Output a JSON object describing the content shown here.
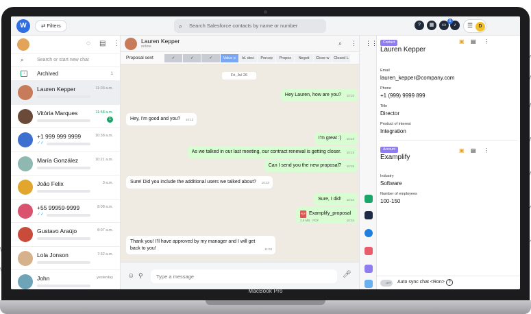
{
  "device": {
    "label": "MacBook Pro"
  },
  "topbar": {
    "logo": "W",
    "filters_label": "Filters",
    "search_placeholder": "Search Salesforce contacts by name or number",
    "notifications_count": "5",
    "avatar_initial": "D"
  },
  "left": {
    "search_placeholder": "Search or start new chat",
    "archived": {
      "label": "Archived",
      "count": "1"
    },
    "chats": [
      {
        "name": "Lauren Kepper",
        "time": "11:03 a.m.",
        "active": true
      },
      {
        "name": "Vitória Marques",
        "time": "11:58 a.m.",
        "unread": "1"
      },
      {
        "name": "+1 999 999 9999",
        "time": "10:38 a.m."
      },
      {
        "name": "María González",
        "time": "10:21 a.m."
      },
      {
        "name": "João Felix",
        "time": "3 a.m."
      },
      {
        "name": "+55 99959-9999",
        "time": "8:08 a.m."
      },
      {
        "name": "Gustavo Araújo",
        "time": "8:07 a.m."
      },
      {
        "name": "Lola Jonson",
        "time": "7:32 a.m."
      },
      {
        "name": "John",
        "time": "yesterday"
      }
    ]
  },
  "chat": {
    "contact_name": "Lauren Kepper",
    "contact_status": "online",
    "stage_label": "Proposal sent",
    "stages": [
      "✓",
      "✓",
      "✓",
      "Value p",
      "Id. deci",
      "Percep",
      "Propos",
      "Negoti",
      "Close w",
      "Closed L"
    ],
    "date": "Fri, Jul 26",
    "messages": [
      {
        "dir": "out",
        "text": "Hey Lauren, how are you?",
        "time": "10:10"
      },
      {
        "dir": "in",
        "text": "Hey, I'm good and you?",
        "time": "10:13"
      },
      {
        "dir": "out",
        "text": "I'm great :)",
        "time": "10:15"
      },
      {
        "dir": "out",
        "text": "As we talked in our last meeting, our contract renewal is getting closer.",
        "time": "10:15"
      },
      {
        "dir": "out",
        "text": "Can I send you the new proposal?",
        "time": "10:16"
      },
      {
        "dir": "in",
        "text": "Sure! Did you include the additional users we talked about?",
        "time": "10:23"
      },
      {
        "dir": "out",
        "text": "Sure, I did!",
        "time": "10:34"
      },
      {
        "dir": "in",
        "text": "Thank you! I'll have approved by my manager and I will get back to you!",
        "time": "11:03"
      }
    ],
    "attachment": {
      "name": "Examplify_proposal",
      "meta": "2.6 MB · PDF",
      "time": "10:34",
      "icon": "PDF"
    },
    "composer_placeholder": "Type a message"
  },
  "right": {
    "contact": {
      "tag": "Contact",
      "name": "Lauren Kepper",
      "fields": [
        {
          "label": "Email",
          "value": "lauren_kepper@company.com"
        },
        {
          "label": "Phone",
          "value": "+1 (999) 9999 899"
        },
        {
          "label": "Title",
          "value": "Director"
        },
        {
          "label": "Product of interest",
          "value": "Integration"
        }
      ],
      "badge": "5"
    },
    "account": {
      "tag": "Account",
      "name": "Examplify",
      "fields": [
        {
          "label": "Industry",
          "value": "Software"
        },
        {
          "label": "Number of employees",
          "value": "100-150"
        }
      ],
      "badge": "5"
    },
    "sync_label": "Auto sync chat <Ron>",
    "sync_toggle": "OFF"
  },
  "colors": {
    "accent": "#2f6de1",
    "outgoing": "#d9fdd3",
    "green": "#1aa56a",
    "chat_bg": "#efeae2"
  }
}
